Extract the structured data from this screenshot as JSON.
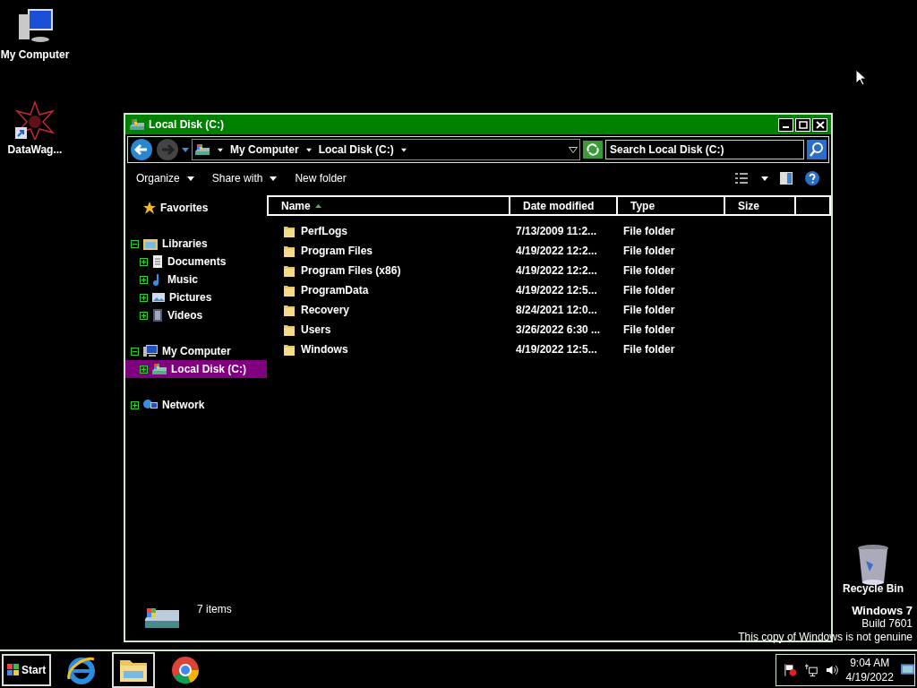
{
  "desktop_icons": [
    {
      "label": "My Computer",
      "kind": "computer"
    },
    {
      "label": "DataWag...",
      "kind": "shortcut"
    },
    {
      "label": "Recycle Bin",
      "kind": "recycle"
    }
  ],
  "window": {
    "title": "Local Disk (C:)",
    "address": {
      "crumbs": [
        "My Computer",
        "Local Disk (C:)"
      ]
    },
    "search": {
      "placeholder": "Search Local Disk (C:)"
    },
    "toolbar": [
      {
        "label": "Organize",
        "menu": true
      },
      {
        "label": "Share with",
        "menu": true
      },
      {
        "label": "New folder",
        "menu": false
      }
    ],
    "nav": [
      {
        "label": "Favorites",
        "kind": "star",
        "selected": false
      },
      {
        "label": "Libraries",
        "kind": "library",
        "expanded": true,
        "selected": false,
        "children": [
          {
            "label": "Documents",
            "kind": "document",
            "expanded": false,
            "selected": false
          },
          {
            "label": "Music",
            "kind": "music",
            "expanded": false,
            "selected": false
          },
          {
            "label": "Pictures",
            "kind": "picture",
            "expanded": false,
            "selected": false
          },
          {
            "label": "Videos",
            "kind": "video",
            "expanded": false,
            "selected": false
          }
        ]
      },
      {
        "label": "My Computer",
        "kind": "computer",
        "expanded": true,
        "selected": false,
        "children": [
          {
            "label": "Local Disk (C:)",
            "kind": "drive",
            "expanded": false,
            "selected": true
          }
        ]
      },
      {
        "label": "Network",
        "kind": "network",
        "expanded": false,
        "selected": false
      }
    ],
    "columns": [
      {
        "label": "Name",
        "sorted": true
      },
      {
        "label": "Date modified",
        "sorted": false
      },
      {
        "label": "Type",
        "sorted": false
      },
      {
        "label": "Size",
        "sorted": false
      }
    ],
    "rows": [
      {
        "name": "PerfLogs",
        "date": "7/13/2009 11:2...",
        "type": "File folder"
      },
      {
        "name": "Program Files",
        "date": "4/19/2022 12:2...",
        "type": "File folder"
      },
      {
        "name": "Program Files (x86)",
        "date": "4/19/2022 12:2...",
        "type": "File folder"
      },
      {
        "name": "ProgramData",
        "date": "4/19/2022 12:5...",
        "type": "File folder"
      },
      {
        "name": "Recovery",
        "date": "8/24/2021 12:0...",
        "type": "File folder"
      },
      {
        "name": "Users",
        "date": "3/26/2022 6:30 ...",
        "type": "File folder"
      },
      {
        "name": "Windows",
        "date": "4/19/2022 12:5...",
        "type": "File folder"
      }
    ],
    "status": "7 items"
  },
  "watermark": [
    "Windows 7",
    "Build 7601",
    "This copy of Windows is not genuine"
  ],
  "taskbar": {
    "start": "Start",
    "apps": [
      {
        "kind": "ie",
        "selected": false
      },
      {
        "kind": "explorer",
        "selected": true
      },
      {
        "kind": "chrome",
        "selected": false
      }
    ],
    "time": "9:04 AM",
    "date": "4/19/2022"
  }
}
